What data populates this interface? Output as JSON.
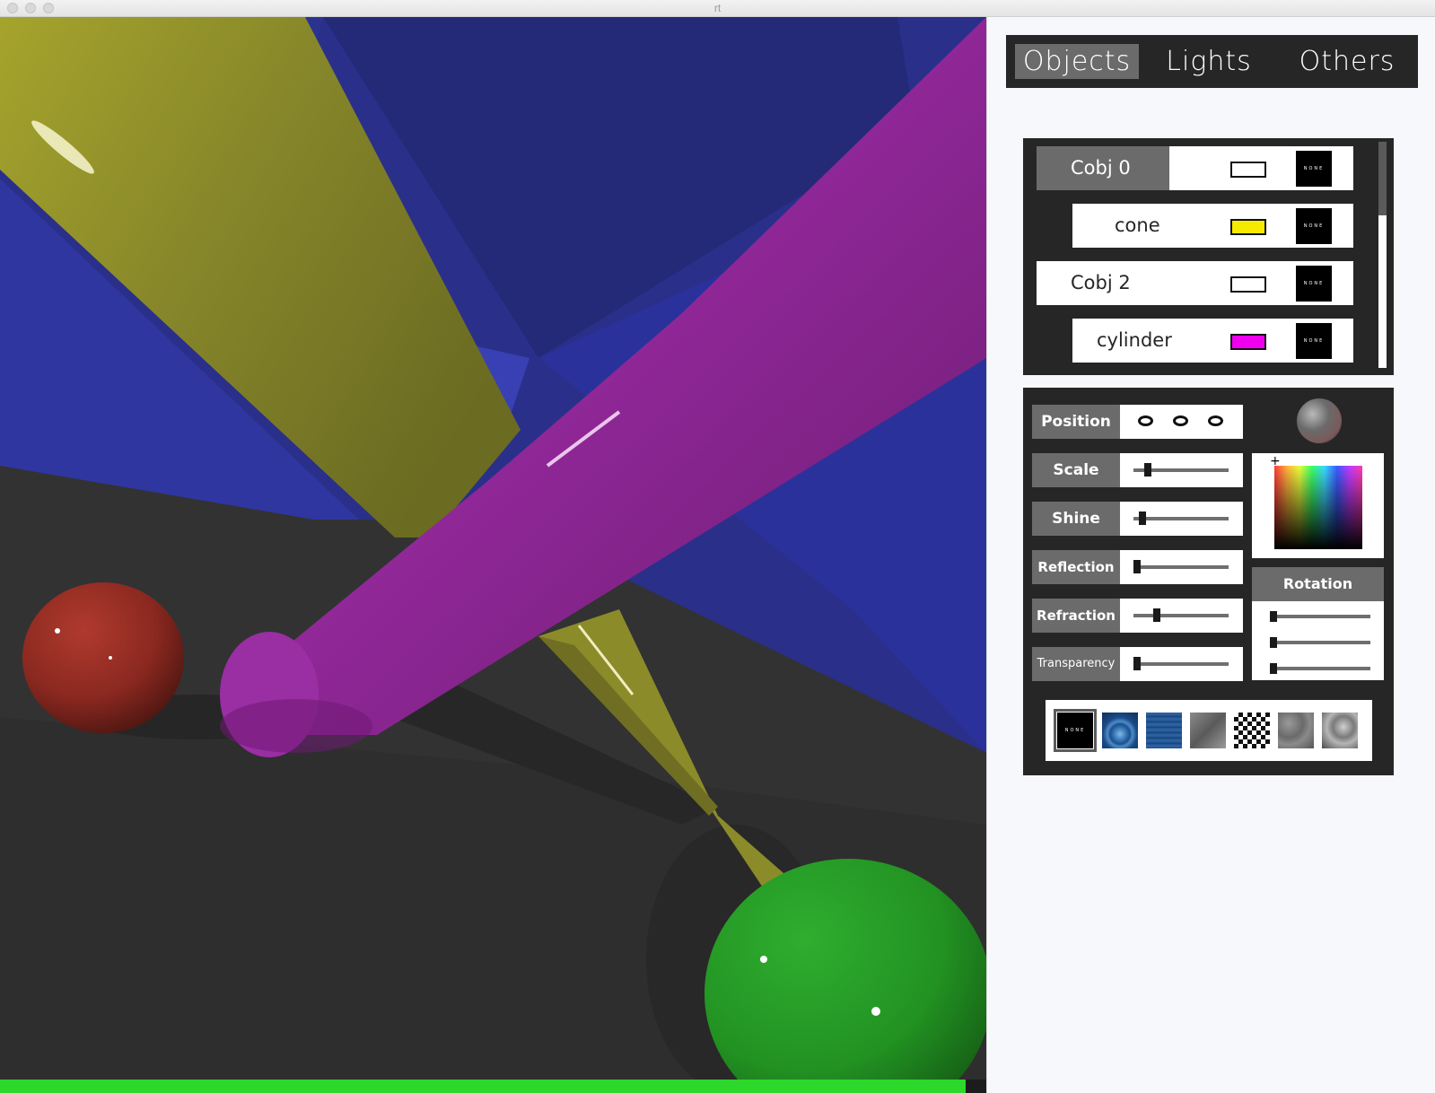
{
  "window": {
    "title": "rt"
  },
  "render": {
    "progress": 1.0,
    "progress_color": "#2bd82b"
  },
  "tabs": [
    {
      "label": "Objects",
      "active": true
    },
    {
      "label": "Lights",
      "active": false
    },
    {
      "label": "Others",
      "active": false
    }
  ],
  "object_list": [
    {
      "name": "Cobj 0",
      "color": "#ffffff",
      "texture": "NONE",
      "selected": true,
      "indent": 0
    },
    {
      "name": "cone",
      "color": "#f5ea00",
      "texture": "NONE",
      "selected": false,
      "indent": 1
    },
    {
      "name": "Cobj 2",
      "color": "#ffffff",
      "texture": "NONE",
      "selected": false,
      "indent": 0
    },
    {
      "name": "cylinder",
      "color": "#ee00ee",
      "texture": "NONE",
      "selected": false,
      "indent": 1
    }
  ],
  "properties": {
    "position": {
      "label": "Position"
    },
    "scale": {
      "label": "Scale",
      "value": 0.12
    },
    "shine": {
      "label": "Shine",
      "value": 0.06
    },
    "reflection": {
      "label": "Reflection",
      "value": 0.0
    },
    "refraction": {
      "label": "Refraction",
      "value": 0.22
    },
    "transparency": {
      "label": "Transparency",
      "value": 0.0
    }
  },
  "rotation": {
    "label": "Rotation",
    "values": [
      0.0,
      0.0,
      0.0
    ]
  },
  "textures": [
    {
      "name": "none",
      "label": "NONE",
      "selected": true
    },
    {
      "name": "ripple",
      "selected": false
    },
    {
      "name": "water",
      "selected": false
    },
    {
      "name": "metal",
      "selected": false
    },
    {
      "name": "checker",
      "selected": false
    },
    {
      "name": "noise",
      "selected": false
    },
    {
      "name": "marble",
      "selected": false
    }
  ]
}
